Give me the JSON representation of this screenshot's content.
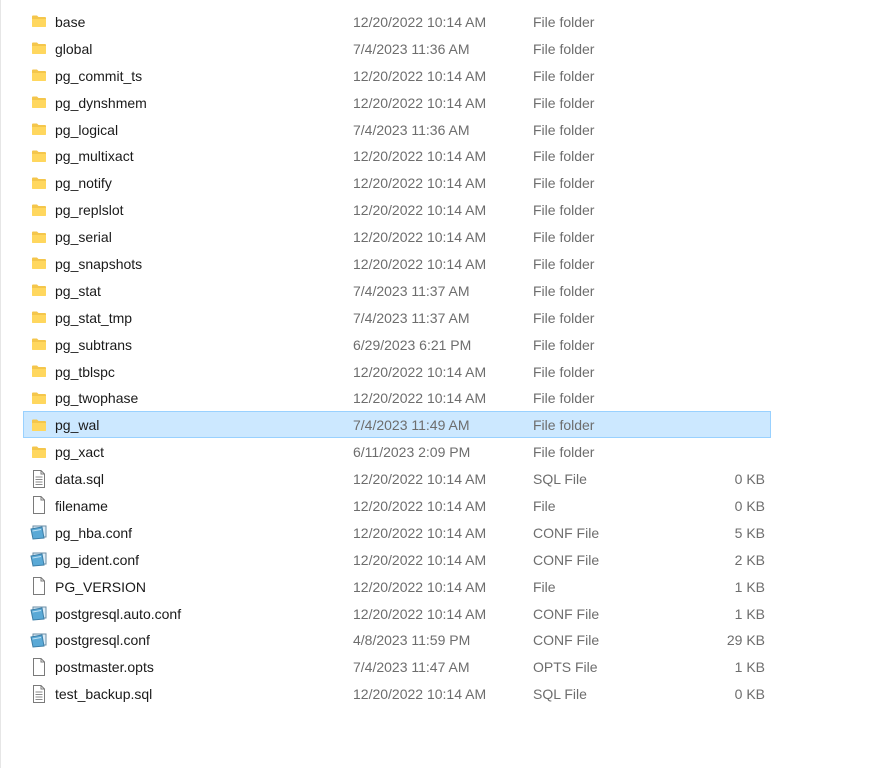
{
  "rows": [
    {
      "name": "base",
      "date": "12/20/2022 10:14 AM",
      "type": "File folder",
      "size": "",
      "icon": "folder-icon"
    },
    {
      "name": "global",
      "date": "7/4/2023 11:36 AM",
      "type": "File folder",
      "size": "",
      "icon": "folder-icon"
    },
    {
      "name": "pg_commit_ts",
      "date": "12/20/2022 10:14 AM",
      "type": "File folder",
      "size": "",
      "icon": "folder-icon"
    },
    {
      "name": "pg_dynshmem",
      "date": "12/20/2022 10:14 AM",
      "type": "File folder",
      "size": "",
      "icon": "folder-icon"
    },
    {
      "name": "pg_logical",
      "date": "7/4/2023 11:36 AM",
      "type": "File folder",
      "size": "",
      "icon": "folder-icon"
    },
    {
      "name": "pg_multixact",
      "date": "12/20/2022 10:14 AM",
      "type": "File folder",
      "size": "",
      "icon": "folder-icon"
    },
    {
      "name": "pg_notify",
      "date": "12/20/2022 10:14 AM",
      "type": "File folder",
      "size": "",
      "icon": "folder-icon"
    },
    {
      "name": "pg_replslot",
      "date": "12/20/2022 10:14 AM",
      "type": "File folder",
      "size": "",
      "icon": "folder-icon"
    },
    {
      "name": "pg_serial",
      "date": "12/20/2022 10:14 AM",
      "type": "File folder",
      "size": "",
      "icon": "folder-icon"
    },
    {
      "name": "pg_snapshots",
      "date": "12/20/2022 10:14 AM",
      "type": "File folder",
      "size": "",
      "icon": "folder-icon"
    },
    {
      "name": "pg_stat",
      "date": "7/4/2023 11:37 AM",
      "type": "File folder",
      "size": "",
      "icon": "folder-icon"
    },
    {
      "name": "pg_stat_tmp",
      "date": "7/4/2023 11:37 AM",
      "type": "File folder",
      "size": "",
      "icon": "folder-icon"
    },
    {
      "name": "pg_subtrans",
      "date": "6/29/2023 6:21 PM",
      "type": "File folder",
      "size": "",
      "icon": "folder-icon"
    },
    {
      "name": "pg_tblspc",
      "date": "12/20/2022 10:14 AM",
      "type": "File folder",
      "size": "",
      "icon": "folder-icon"
    },
    {
      "name": "pg_twophase",
      "date": "12/20/2022 10:14 AM",
      "type": "File folder",
      "size": "",
      "icon": "folder-icon"
    },
    {
      "name": "pg_wal",
      "date": "7/4/2023 11:49 AM",
      "type": "File folder",
      "size": "",
      "icon": "folder-icon",
      "selected": true
    },
    {
      "name": "pg_xact",
      "date": "6/11/2023 2:09 PM",
      "type": "File folder",
      "size": "",
      "icon": "folder-icon"
    },
    {
      "name": "data.sql",
      "date": "12/20/2022 10:14 AM",
      "type": "SQL File",
      "size": "0 KB",
      "icon": "text-file-icon"
    },
    {
      "name": "filename",
      "date": "12/20/2022 10:14 AM",
      "type": "File",
      "size": "0 KB",
      "icon": "blank-file-icon"
    },
    {
      "name": "pg_hba.conf",
      "date": "12/20/2022 10:14 AM",
      "type": "CONF File",
      "size": "5 KB",
      "icon": "conf-file-icon"
    },
    {
      "name": "pg_ident.conf",
      "date": "12/20/2022 10:14 AM",
      "type": "CONF File",
      "size": "2 KB",
      "icon": "conf-file-icon"
    },
    {
      "name": "PG_VERSION",
      "date": "12/20/2022 10:14 AM",
      "type": "File",
      "size": "1 KB",
      "icon": "blank-file-icon"
    },
    {
      "name": "postgresql.auto.conf",
      "date": "12/20/2022 10:14 AM",
      "type": "CONF File",
      "size": "1 KB",
      "icon": "conf-file-icon"
    },
    {
      "name": "postgresql.conf",
      "date": "4/8/2023 11:59 PM",
      "type": "CONF File",
      "size": "29 KB",
      "icon": "conf-file-icon"
    },
    {
      "name": "postmaster.opts",
      "date": "7/4/2023 11:47 AM",
      "type": "OPTS File",
      "size": "1 KB",
      "icon": "blank-file-icon"
    },
    {
      "name": "test_backup.sql",
      "date": "12/20/2022 10:14 AM",
      "type": "SQL File",
      "size": "0 KB",
      "icon": "text-file-icon"
    }
  ],
  "colors": {
    "selection_bg": "#cce8ff",
    "selection_border": "#99d1ff",
    "folder": "#ffd75e",
    "conf": "#5aa9d6"
  }
}
